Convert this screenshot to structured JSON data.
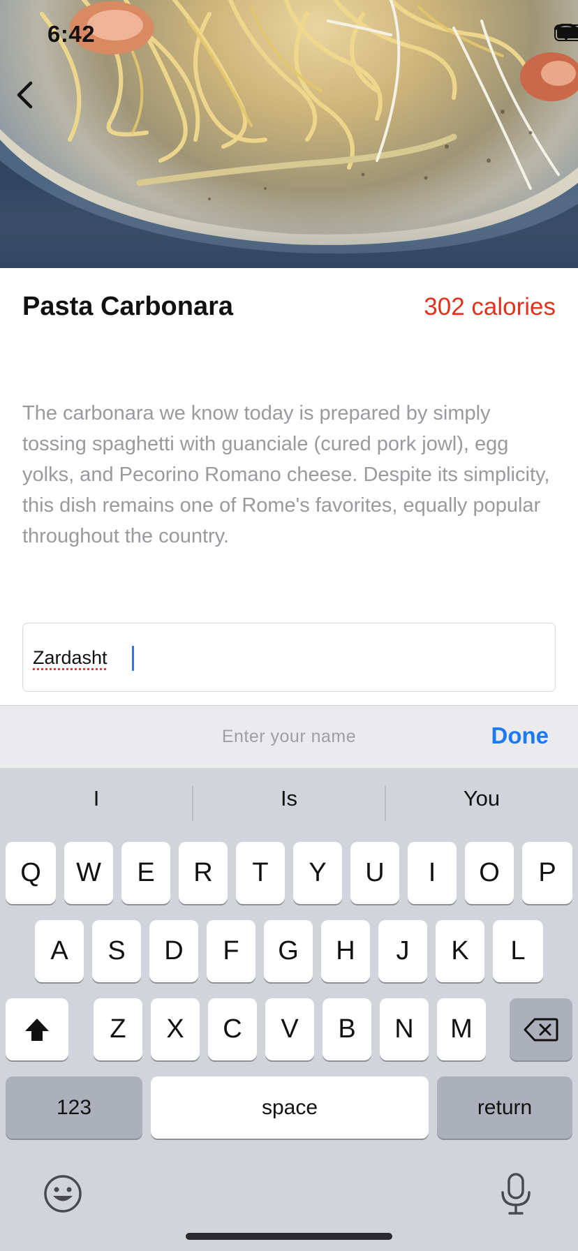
{
  "status_bar": {
    "time": "6:42"
  },
  "recipe": {
    "title": "Pasta Carbonara",
    "calories": "302 calories",
    "description": "The carbonara we know today is prepared by simply tossing spaghetti with guanciale (cured pork jowl), egg yolks, and Pecorino Romano cheese. Despite its simplicity, this dish remains one of Rome's favorites, equally popular throughout the country."
  },
  "name_field": {
    "value": "Zardasht"
  },
  "toolbar": {
    "placeholder": "Enter  your name",
    "done_label": "Done"
  },
  "keyboard": {
    "suggestions": [
      "I",
      "Is",
      "You"
    ],
    "row1": [
      "Q",
      "W",
      "E",
      "R",
      "T",
      "Y",
      "U",
      "I",
      "O",
      "P"
    ],
    "row2": [
      "A",
      "S",
      "D",
      "F",
      "G",
      "H",
      "J",
      "K",
      "L"
    ],
    "row3": [
      "Z",
      "X",
      "C",
      "V",
      "B",
      "N",
      "M"
    ],
    "numbers_label": "123",
    "space_label": "space",
    "return_label": "return"
  },
  "colors": {
    "accent": "#1b7cf2",
    "calories": "#e2321e",
    "caret": "#3a6fe8"
  }
}
